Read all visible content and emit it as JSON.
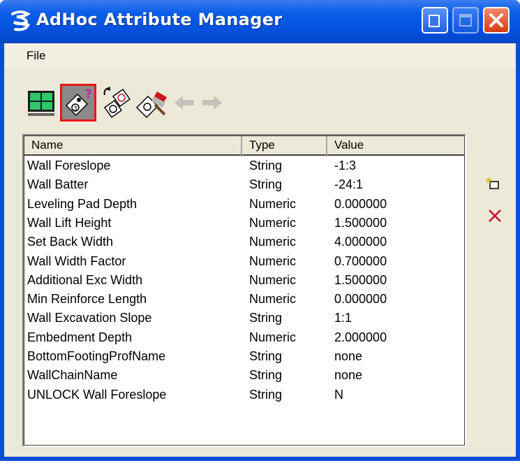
{
  "window": {
    "title": "AdHoc Attribute Manager",
    "title_color": "#ffffff",
    "titlebar_color": "#0a5de6"
  },
  "menu": {
    "file_label": "File"
  },
  "toolbar": {
    "buttons": [
      {
        "icon": "grid-view-icon",
        "pressed": false
      },
      {
        "icon": "attribute-help-icon",
        "pressed": true
      },
      {
        "icon": "attach-tag-icon",
        "pressed": false
      },
      {
        "icon": "paint-attribute-icon",
        "pressed": false
      },
      {
        "icon": "arrow-left-icon",
        "enabled": false
      },
      {
        "icon": "arrow-right-icon",
        "enabled": false
      }
    ]
  },
  "table": {
    "columns": [
      "Name",
      "Type",
      "Value"
    ],
    "rows": [
      {
        "name": "Wall Foreslope",
        "type": "String",
        "value": "-1:3"
      },
      {
        "name": "Wall Batter",
        "type": "String",
        "value": "-24:1"
      },
      {
        "name": "Leveling Pad Depth",
        "type": "Numeric",
        "value": "0.000000"
      },
      {
        "name": "Wall Lift Height",
        "type": "Numeric",
        "value": "1.500000"
      },
      {
        "name": "Set Back Width",
        "type": "Numeric",
        "value": "4.000000"
      },
      {
        "name": "Wall Width Factor",
        "type": "Numeric",
        "value": "0.700000"
      },
      {
        "name": "Additional Exc Width",
        "type": "Numeric",
        "value": "1.500000"
      },
      {
        "name": "Min Reinforce Length",
        "type": "Numeric",
        "value": "0.000000"
      },
      {
        "name": "Wall Excavation Slope",
        "type": "String",
        "value": "1:1"
      },
      {
        "name": "Embedment Depth",
        "type": "Numeric",
        "value": "2.000000"
      },
      {
        "name": "BottomFootingProfName",
        "type": "String",
        "value": "none"
      },
      {
        "name": "WallChainName",
        "type": "String",
        "value": "none"
      },
      {
        "name": "UNLOCK Wall Foreslope",
        "type": "String",
        "value": "N"
      }
    ]
  },
  "side_actions": {
    "new_icon": "new-attribute-icon",
    "delete_icon": "delete-icon",
    "delete_color": "#c8102e"
  }
}
